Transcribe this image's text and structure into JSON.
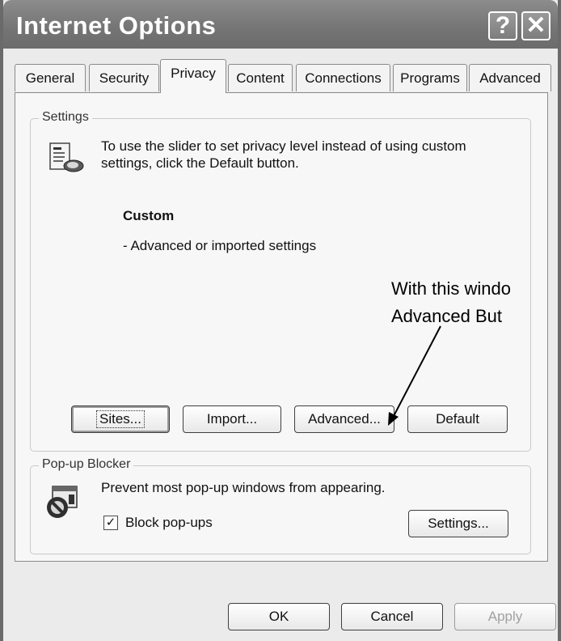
{
  "window": {
    "title": "Internet Options",
    "help_glyph": "?",
    "close_glyph": "✕"
  },
  "tabs": [
    {
      "label": "General"
    },
    {
      "label": "Security"
    },
    {
      "label": "Privacy",
      "active": true
    },
    {
      "label": "Content"
    },
    {
      "label": "Connections"
    },
    {
      "label": "Programs"
    },
    {
      "label": "Advanced"
    }
  ],
  "settings": {
    "group_label": "Settings",
    "description_line1": "To use the slider to set privacy level instead of using custom",
    "description_line2": "settings, click the Default button.",
    "level_name": "Custom",
    "level_desc": "- Advanced or imported settings",
    "buttons": {
      "sites": "Sites...",
      "import": "Import...",
      "advanced": "Advanced...",
      "default": "Default"
    }
  },
  "annotation": {
    "line1": "With this windo",
    "line2": "Advanced But"
  },
  "popup_blocker": {
    "group_label": "Pop-up Blocker",
    "description": "Prevent most pop-up windows from appearing.",
    "checkbox_label": "Block pop-ups",
    "checkbox_checked": true,
    "settings_button": "Settings..."
  },
  "footer": {
    "ok": "OK",
    "cancel": "Cancel",
    "apply": "Apply"
  }
}
